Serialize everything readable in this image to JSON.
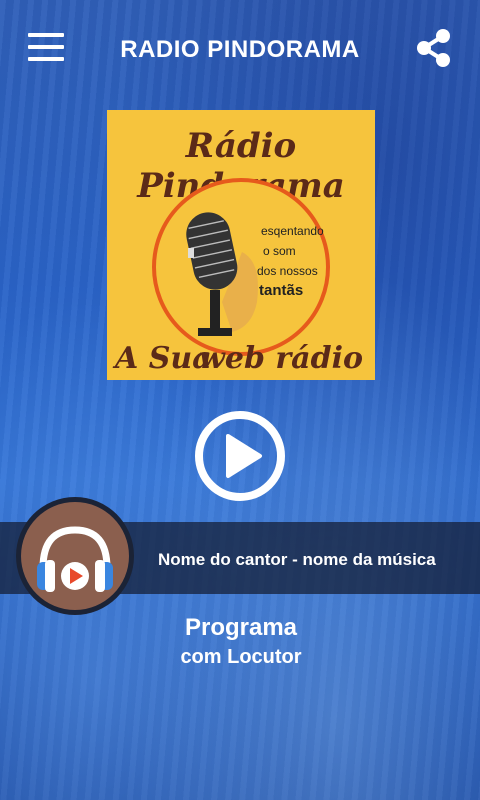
{
  "header": {
    "title": "RADIO PINDORAMA",
    "menu_icon": "hamburger-menu-icon",
    "share_icon": "share-icon"
  },
  "logo": {
    "title": "Rádio Pindorama",
    "tagline_1": "esqentando",
    "tagline_2": "o som",
    "tagline_3": "dos nossos",
    "tagline_4": "tantãs",
    "bottom_left": "A Sua",
    "bottom_right": "web rádio"
  },
  "player": {
    "play_icon": "play-icon",
    "now_playing": "Nome do cantor - nome da música",
    "avatar_icon": "headphones-play-icon"
  },
  "program": {
    "name": "Programa",
    "host": "com Locutor"
  },
  "colors": {
    "logo_background": "#f6c43d",
    "logo_text": "#5b2a18",
    "logo_ring": "#e65a1c",
    "avatar_background": "#8b5f4e",
    "headphones": "#3a86e0",
    "play_accent": "#e8492b"
  }
}
